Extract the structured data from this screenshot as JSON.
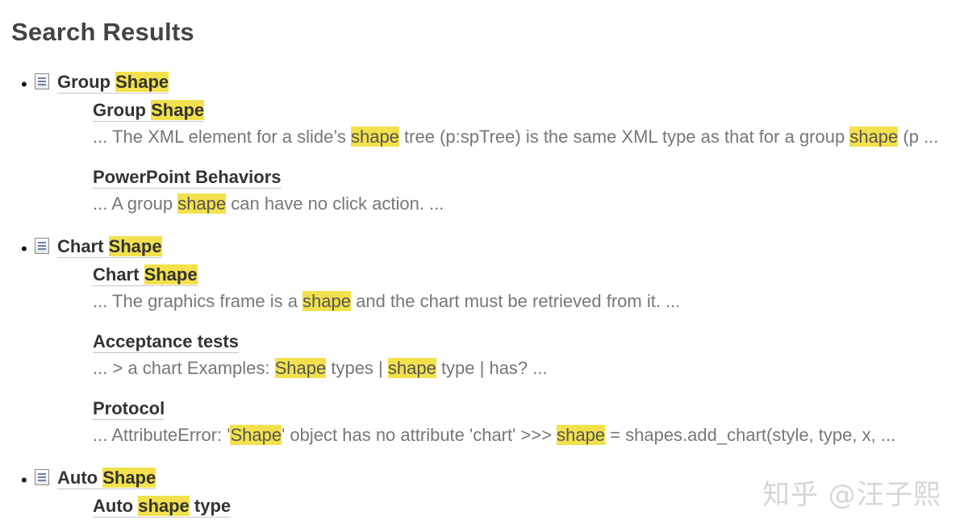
{
  "page": {
    "title": "Search Results"
  },
  "results": [
    {
      "title_pre": "Group ",
      "title_hl": "Shape",
      "sections": [
        {
          "title_pre": "Group ",
          "title_hl": "Shape",
          "snippet": [
            {
              "t": "... The XML element for a slide’s ",
              "h": false
            },
            {
              "t": "shape",
              "h": true
            },
            {
              "t": " tree (p:spTree) is the same XML type as that for a group ",
              "h": false
            },
            {
              "t": "shape",
              "h": true
            },
            {
              "t": " (p ...",
              "h": false
            }
          ]
        },
        {
          "title_pre": "PowerPoint Behaviors",
          "title_hl": "",
          "snippet": [
            {
              "t": "... A group ",
              "h": false
            },
            {
              "t": "shape",
              "h": true
            },
            {
              "t": " can have no click action. ...",
              "h": false
            }
          ]
        }
      ]
    },
    {
      "title_pre": "Chart ",
      "title_hl": "Shape",
      "sections": [
        {
          "title_pre": "Chart ",
          "title_hl": "Shape",
          "snippet": [
            {
              "t": "... The graphics frame is a ",
              "h": false
            },
            {
              "t": "shape",
              "h": true
            },
            {
              "t": " and the chart must be retrieved from it. ...",
              "h": false
            }
          ]
        },
        {
          "title_pre": "Acceptance tests",
          "title_hl": "",
          "snippet": [
            {
              "t": "... > a chart Examples: ",
              "h": false
            },
            {
              "t": "Shape",
              "h": true
            },
            {
              "t": " types | ",
              "h": false
            },
            {
              "t": "shape",
              "h": true
            },
            {
              "t": " type | has? ...",
              "h": false
            }
          ]
        },
        {
          "title_pre": "Protocol",
          "title_hl": "",
          "snippet": [
            {
              "t": "... AttributeError: '",
              "h": false
            },
            {
              "t": "Shape",
              "h": true
            },
            {
              "t": "' object has no attribute 'chart' >>> ",
              "h": false
            },
            {
              "t": "shape",
              "h": true
            },
            {
              "t": " = shapes.add_chart(style, type, x, ...",
              "h": false
            }
          ]
        }
      ]
    },
    {
      "title_pre": "Auto ",
      "title_hl": "Shape",
      "sections": [
        {
          "title_pre": "Auto ",
          "title_hl": "shape",
          "title_post": " type",
          "snippet": []
        }
      ]
    }
  ],
  "watermark": "知乎 @汪子熙",
  "colors": {
    "highlight": "#f2e14d",
    "title_text": "#333333",
    "snippet_text": "#777777"
  }
}
